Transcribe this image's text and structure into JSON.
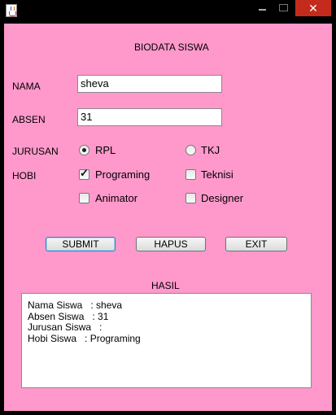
{
  "form": {
    "title": "BIODATA SISWA",
    "nama_label": "NAMA",
    "nama_value": "sheva",
    "absen_label": "ABSEN",
    "absen_value": "31",
    "jurusan_label": "JURUSAN",
    "jurusan_options": [
      {
        "label": "RPL",
        "selected": true
      },
      {
        "label": "TKJ",
        "selected": false
      }
    ],
    "hobi_label": "HOBI",
    "hobi_options": [
      {
        "label": "Programing",
        "checked": true
      },
      {
        "label": "Teknisi",
        "checked": false
      },
      {
        "label": "Animator",
        "checked": false
      },
      {
        "label": "Designer",
        "checked": false
      }
    ]
  },
  "buttons": {
    "submit": "SUBMIT",
    "hapus": "HAPUS",
    "exit": "EXIT"
  },
  "hasil": {
    "label": "HASIL",
    "lines": [
      "Nama Siswa   : sheva",
      "Absen Siswa   : 31",
      "Jurusan Siswa   :",
      "Hobi Siswa   : Programing"
    ]
  },
  "window": {
    "close_glyph": "✕",
    "accent_close": "#c42b1c",
    "background": "#ff99cc"
  }
}
